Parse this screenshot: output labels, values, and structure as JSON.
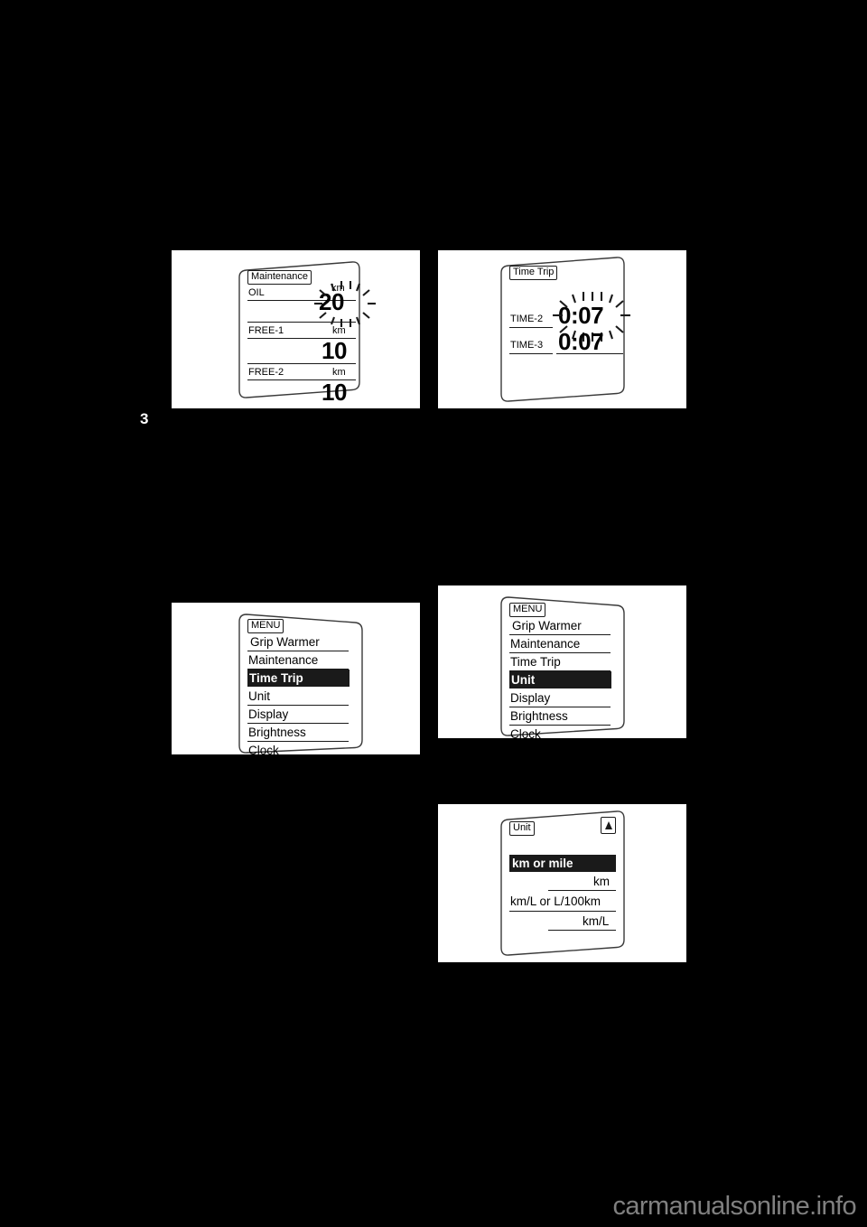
{
  "page": {
    "background_color": "#000000",
    "chapter_marker": "3",
    "watermark": "carmanualsonline.info"
  },
  "figures": {
    "maintenance": {
      "tag": "Maintenance",
      "rows": [
        {
          "label": "OIL",
          "unit": "km",
          "value": "20",
          "flashing": true
        },
        {
          "label": "FREE-1",
          "unit": "km",
          "value": "10",
          "flashing": false
        },
        {
          "label": "FREE-2",
          "unit": "km",
          "value": "10",
          "flashing": false
        }
      ]
    },
    "time_trip": {
      "tag": "Time Trip",
      "rows": [
        {
          "label": "TIME-2",
          "value": "0:07",
          "flashing": true
        },
        {
          "label": "TIME-3",
          "value": "0:07",
          "flashing": false
        }
      ]
    },
    "menu_time_trip": {
      "tag": "MENU",
      "items": [
        {
          "label": "Grip Warmer",
          "selected": false
        },
        {
          "label": "Maintenance",
          "selected": false
        },
        {
          "label": "Time Trip",
          "selected": true
        },
        {
          "label": "Unit",
          "selected": false
        },
        {
          "label": "Display",
          "selected": false
        },
        {
          "label": "Brightness",
          "selected": false
        },
        {
          "label": "Clock",
          "selected": false
        }
      ]
    },
    "menu_unit": {
      "tag": "MENU",
      "items": [
        {
          "label": "Grip Warmer",
          "selected": false
        },
        {
          "label": "Maintenance",
          "selected": false
        },
        {
          "label": "Time Trip",
          "selected": false
        },
        {
          "label": "Unit",
          "selected": true
        },
        {
          "label": "Display",
          "selected": false
        },
        {
          "label": "Brightness",
          "selected": false
        },
        {
          "label": "Clock",
          "selected": false
        }
      ]
    },
    "unit_screen": {
      "tag": "Unit",
      "up_icon": "up-triangle-icon",
      "rows": [
        {
          "label": "km or mile",
          "selected": true,
          "value": "km"
        },
        {
          "label": "km/L or L/100km",
          "selected": false,
          "value": "km/L"
        }
      ]
    }
  }
}
